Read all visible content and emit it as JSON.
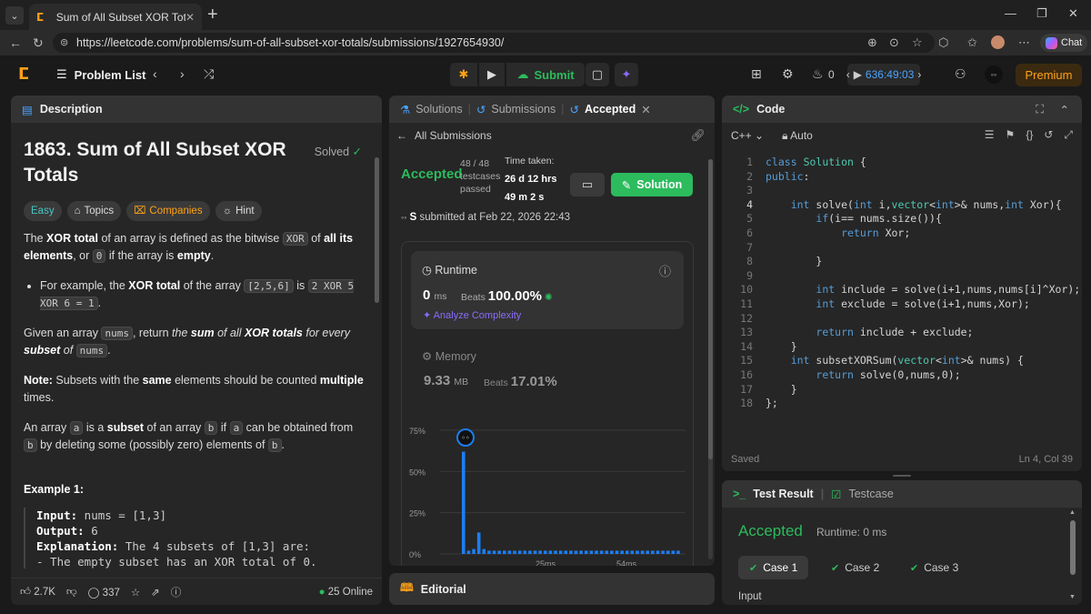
{
  "browser": {
    "tab_title": "Sum of All Subset XOR Totals - Lee",
    "url": "https://leetcode.com/problems/sum-of-all-subset-xor-totals/submissions/1927654930/",
    "chat_label": "Chat"
  },
  "nav": {
    "problem_list": "Problem List",
    "submit": "Submit",
    "streak": "0",
    "timer": "636:49:03",
    "premium": "Premium"
  },
  "description": {
    "tab_label": "Description",
    "title": "1863. Sum of All Subset XOR Totals",
    "solved": "Solved",
    "tags": {
      "difficulty": "Easy",
      "topics": "Topics",
      "companies": "Companies",
      "hint": "Hint"
    },
    "p1": {
      "pre": "The ",
      "b1": "XOR total",
      "mid1": " of an array is defined as the bitwise ",
      "code1": "XOR",
      "mid2": " of ",
      "b2": "all its elements",
      "mid3": ", or ",
      "code2": "0",
      "mid4": " if the array is ",
      "b3": "empty",
      "post": "."
    },
    "bullet": {
      "pre": "For example, the ",
      "b1": "XOR total",
      "mid1": " of the array ",
      "code1": "[2,5,6]",
      "mid2": " is ",
      "code2": "2 XOR 5 XOR 6 = 1",
      "post": "."
    },
    "p2": {
      "pre": "Given an array ",
      "code1": "nums",
      "mid1": ", return ",
      "i1": "the ",
      "b1": "sum",
      "i2": " of all ",
      "b2": "XOR totals",
      "i3": " for every ",
      "b3": "subset",
      "i4": " of ",
      "code2": "nums",
      "post": "."
    },
    "note": {
      "b1": "Note:",
      "t1": " Subsets with the ",
      "b2": "same",
      "t2": " elements should be counted ",
      "b3": "multiple",
      "t3": " times."
    },
    "p3": {
      "pre": "An array ",
      "code1": "a",
      "mid1": " is a ",
      "b1": "subset",
      "mid2": " of an array ",
      "code2": "b",
      "mid3": " if ",
      "code3": "a",
      "mid4": " can be obtained from ",
      "code4": "b",
      "mid5": " by deleting some (possibly zero) elements of ",
      "code5": "b",
      "post": "."
    },
    "example_title": "Example 1:",
    "example": {
      "input_label": "Input:",
      "input": " nums = [1,3]",
      "output_label": "Output:",
      "output": " 6",
      "explanation_label": "Explanation:",
      "explanation": " The 4 subsets of [1,3] are:",
      "line1": "- The empty subset has an XOR total of 0."
    },
    "footer": {
      "likes": "2.7K",
      "comments": "337",
      "online": "25 Online"
    }
  },
  "submission": {
    "tabs": {
      "solutions": "Solutions",
      "submissions": "Submissions",
      "accepted": "Accepted"
    },
    "all_submissions": "All Submissions",
    "status": "Accepted",
    "testcases": "48 / 48",
    "testcases_label": "testcases passed",
    "time_taken_label": "Time taken:",
    "time_taken_1": "26 d 12 hrs",
    "time_taken_2": "49 m 2 s",
    "solution_btn": "Solution",
    "submitter": "S",
    "submitted_at": " submitted at Feb 22, 2026 22:43",
    "runtime": {
      "label": "Runtime",
      "value": "0",
      "unit": "ms",
      "beats_label": "Beats",
      "beats": "100.00%",
      "analyze": "Analyze Complexity"
    },
    "memory": {
      "label": "Memory",
      "value": "9.33",
      "unit": "MB",
      "beats_label": "Beats",
      "beats": "17.01%"
    },
    "editorial": "Editorial"
  },
  "chart_data": {
    "type": "bar",
    "yticks": [
      "75%",
      "50%",
      "25%",
      "0%"
    ],
    "ylim": [
      0,
      75
    ],
    "xticks": [
      "25ms",
      "54ms"
    ],
    "values": [
      62,
      2,
      3,
      13,
      3,
      2,
      2,
      2,
      2,
      2,
      2,
      2,
      2,
      2,
      2,
      2,
      2,
      2,
      2,
      2,
      2,
      2,
      2,
      2,
      2,
      2,
      2,
      2,
      2,
      2,
      2,
      2,
      2,
      2,
      2,
      2,
      2,
      2,
      2,
      2,
      2,
      2,
      2
    ],
    "accent": "#1d7df0"
  },
  "code": {
    "tab_label": "Code",
    "language": "C++",
    "auto": "Auto",
    "status": "Saved",
    "cursor": "Ln 4, Col 39",
    "lines": [
      "class Solution {",
      "public:",
      "",
      "    int solve(int i,vector<int>& nums,int Xor){",
      "        if(i== nums.size()){",
      "            return Xor;",
      "",
      "        }",
      "",
      "        int include = solve(i+1,nums,nums[i]^Xor);",
      "        int exclude = solve(i+1,nums,Xor);",
      "",
      "        return include + exclude;",
      "    }",
      "    int subsetXORSum(vector<int>& nums) {",
      "        return solve(0,nums,0);",
      "    }",
      "};"
    ]
  },
  "test": {
    "tab_label": "Test Result",
    "testcase_tab": "Testcase",
    "status": "Accepted",
    "runtime": "Runtime: 0 ms",
    "cases": [
      "Case 1",
      "Case 2",
      "Case 3"
    ],
    "input_label": "Input"
  },
  "colors": {
    "accepted": "#2cbb5d",
    "brand": "#ffa116",
    "link": "#4aa3ff"
  }
}
